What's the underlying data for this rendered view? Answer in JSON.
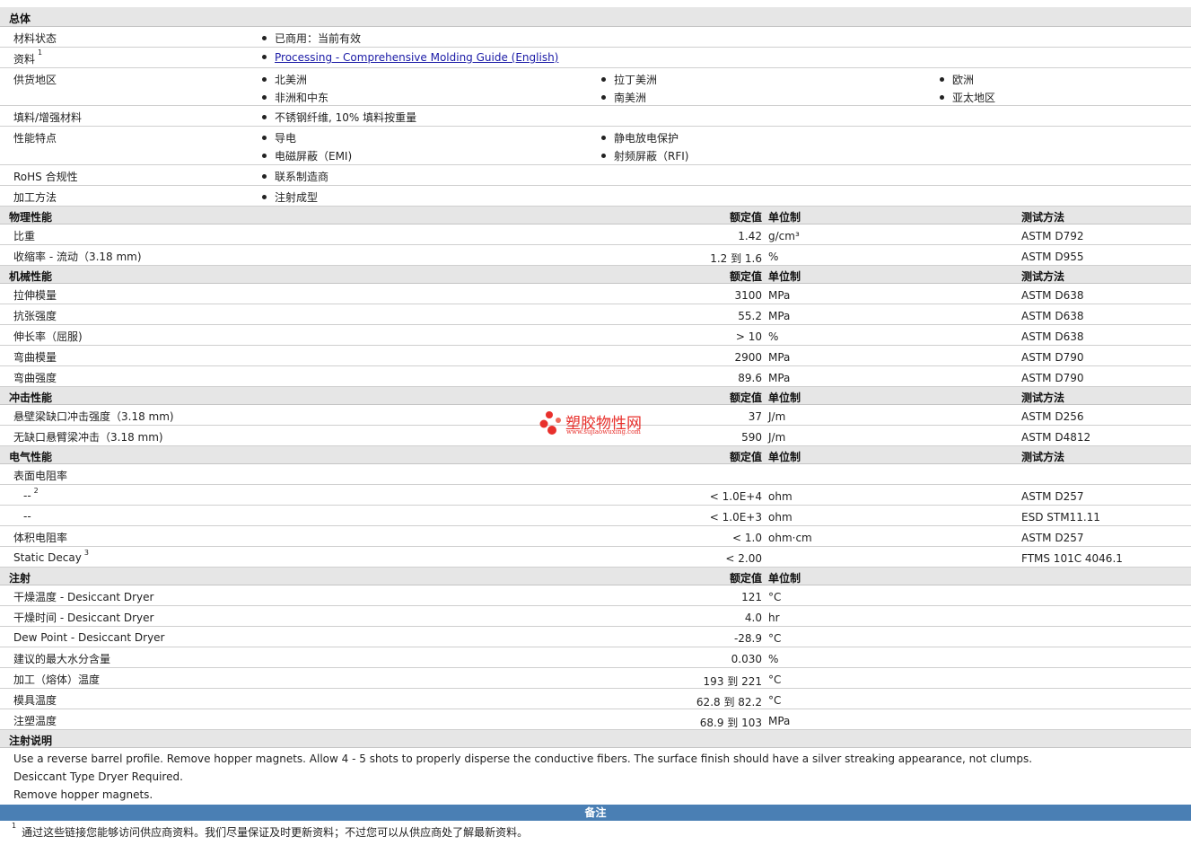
{
  "general": {
    "title": "总体",
    "status_label": "材料状态",
    "status_value": "已商用：当前有效",
    "docs_label": "资料",
    "docs_sup": "1",
    "docs_link": "Processing - Comprehensive Molding Guide (English)",
    "supply_label": "供货地区",
    "supply": [
      "北美洲",
      "拉丁美洲",
      "欧洲",
      "非洲和中东",
      "南美洲",
      "亚太地区"
    ],
    "filler_label": "填料/增强材料",
    "filler_value": "不锈钢纤维, 10% 填料按重量",
    "features_label": "性能特点",
    "features": [
      "导电",
      "静电放电保护",
      "电磁屏蔽（EMI)",
      "射频屏蔽（RFI)"
    ],
    "rohs_label": "RoHS 合规性",
    "rohs_value": "联系制造商",
    "process_label": "加工方法",
    "process_value": "注射成型"
  },
  "columns": {
    "value": "额定值",
    "unit": "单位制",
    "test": "测试方法"
  },
  "physical": {
    "title": "物理性能",
    "rows": [
      {
        "label": "比重",
        "value": "1.42",
        "unit": "g/cm³",
        "test": "ASTM D792"
      },
      {
        "label": "收缩率  - 流动（3.18 mm)",
        "value": "1.2 到  1.6",
        "unit": "%",
        "test": "ASTM D955"
      }
    ]
  },
  "mechanical": {
    "title": "机械性能",
    "rows": [
      {
        "label": "拉伸模量",
        "value": "3100",
        "unit": "MPa",
        "test": "ASTM D638"
      },
      {
        "label": "抗张强度",
        "value": "55.2",
        "unit": "MPa",
        "test": "ASTM D638"
      },
      {
        "label": "伸长率（屈服)",
        "value": "> 10",
        "unit": "%",
        "test": "ASTM D638"
      },
      {
        "label": "弯曲模量",
        "value": "2900",
        "unit": "MPa",
        "test": "ASTM D790"
      },
      {
        "label": "弯曲强度",
        "value": "89.6",
        "unit": "MPa",
        "test": "ASTM D790"
      }
    ]
  },
  "impact": {
    "title": "冲击性能",
    "rows": [
      {
        "label": "悬壁梁缺口冲击强度（3.18 mm)",
        "value": "37",
        "unit": "J/m",
        "test": "ASTM D256"
      },
      {
        "label": "无缺口悬臂梁冲击（3.18 mm)",
        "value": "590",
        "unit": "J/m",
        "test": "ASTM D4812"
      }
    ]
  },
  "electrical": {
    "title": "电气性能",
    "surface_label": "表面电阻率",
    "rows": [
      {
        "label": "--",
        "sup": "2",
        "value": "< 1.0E+4",
        "unit": "ohm",
        "test": "ASTM D257"
      },
      {
        "label": "--",
        "sup": "",
        "value": "< 1.0E+3",
        "unit": "ohm",
        "test": "ESD STM11.11"
      },
      {
        "label": "体积电阻率",
        "sup": "",
        "value": "< 1.0",
        "unit": "ohm·cm",
        "test": "ASTM D257"
      },
      {
        "label": "Static Decay",
        "sup": "3",
        "value": "< 2.00",
        "unit": "",
        "test": "FTMS 101C 4046.1"
      }
    ]
  },
  "injection": {
    "title": "注射",
    "rows": [
      {
        "label": "干燥温度  - Desiccant Dryer",
        "value": "121",
        "unit": "°C"
      },
      {
        "label": "干燥时间  - Desiccant Dryer",
        "value": "4.0",
        "unit": "hr"
      },
      {
        "label": "Dew Point - Desiccant Dryer",
        "value": "-28.9",
        "unit": "°C"
      },
      {
        "label": "建议的最大水分含量",
        "value": "0.030",
        "unit": "%"
      },
      {
        "label": "加工（熔体）温度",
        "value": "193 到  221",
        "unit": "°C"
      },
      {
        "label": "模具温度",
        "value": "62.8 到  82.2",
        "unit": "°C"
      },
      {
        "label": "注塑温度",
        "value": "68.9 到  103",
        "unit": "MPa"
      }
    ]
  },
  "injection_notes": {
    "title": "注射说明",
    "lines": [
      "Use a reverse barrel profile. Remove hopper magnets. Allow 4 - 5 shots to properly disperse the conductive fibers. The surface finish should have a silver streaking appearance, not clumps.",
      "Desiccant Type Dryer Required.",
      "Remove hopper magnets."
    ]
  },
  "notes": {
    "title": "备注",
    "sup": "1",
    "text": "通过这些链接您能够访问供应商资料。我们尽量保证及时更新资料；不过您可以从供应商处了解最新资料。"
  },
  "watermark": {
    "name": "塑胶物性网",
    "url": "www.sujiaowuxing.com",
    "color": "#e8302c"
  }
}
